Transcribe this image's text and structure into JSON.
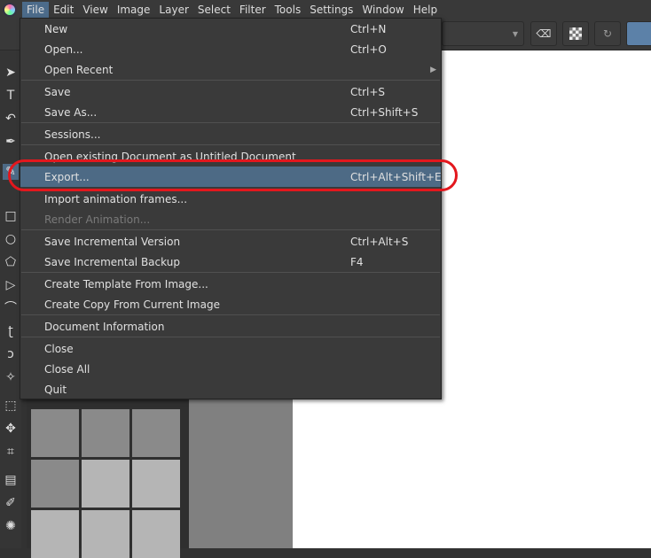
{
  "menubar": [
    "File",
    "Edit",
    "View",
    "Image",
    "Layer",
    "Select",
    "Filter",
    "Tools",
    "Settings",
    "Window",
    "Help"
  ],
  "file_menu": [
    {
      "label": "New",
      "shortcut": "Ctrl+N"
    },
    {
      "label": "Open...",
      "shortcut": "Ctrl+O"
    },
    {
      "label": "Open Recent",
      "shortcut": "",
      "submenu": true
    },
    {
      "label": "Save",
      "shortcut": "Ctrl+S"
    },
    {
      "label": "Save As...",
      "shortcut": "Ctrl+Shift+S"
    },
    {
      "label": "Sessions...",
      "shortcut": ""
    },
    {
      "label": "Open existing Document as Untitled Document",
      "shortcut": ""
    },
    {
      "label": "Export...",
      "shortcut": "Ctrl+Alt+Shift+E",
      "highlighted": true
    },
    {
      "label": "Import animation frames...",
      "shortcut": ""
    },
    {
      "label": "Render Animation...",
      "shortcut": "",
      "disabled": true
    },
    {
      "label": "Save Incremental Version",
      "shortcut": "Ctrl+Alt+S"
    },
    {
      "label": "Save Incremental Backup",
      "shortcut": "F4"
    },
    {
      "label": "Create Template From Image...",
      "shortcut": ""
    },
    {
      "label": "Create Copy From Current Image",
      "shortcut": ""
    },
    {
      "label": "Document Information",
      "shortcut": ""
    },
    {
      "label": "Close",
      "shortcut": ""
    },
    {
      "label": "Close All",
      "shortcut": ""
    },
    {
      "label": "Quit",
      "shortcut": ""
    }
  ],
  "annotation_color": "#e3171d",
  "highlight_color": "#4d6a85"
}
